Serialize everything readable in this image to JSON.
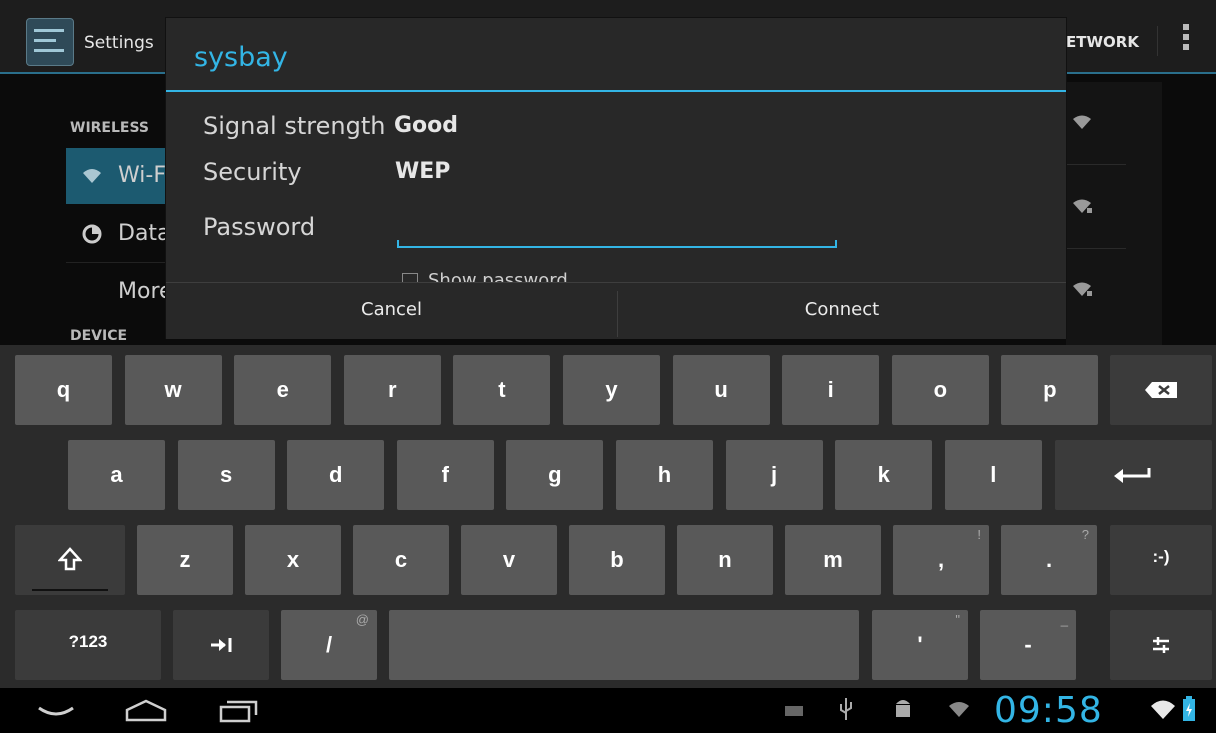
{
  "app": {
    "title": "Settings",
    "network_label": "ETWORK",
    "headers": {
      "wireless": "WIRELESS",
      "device": "DEVICE"
    },
    "sidebar": [
      {
        "label": "Wi-Fi",
        "icon": "wifi-icon",
        "selected": true
      },
      {
        "label": "Data",
        "icon": "data-usage-icon"
      },
      {
        "label": "More"
      }
    ],
    "accent_color": "#33b5e5"
  },
  "dialog": {
    "title": "sysbay",
    "signal_label": "Signal strength",
    "signal_value": "Good",
    "security_label": "Security",
    "security_value": "WEP",
    "password_label": "Password",
    "password_value": "",
    "show_password_label": "Show password",
    "cancel_label": "Cancel",
    "connect_label": "Connect"
  },
  "keyboard": {
    "row1": [
      "q",
      "w",
      "e",
      "r",
      "t",
      "y",
      "u",
      "i",
      "o",
      "p"
    ],
    "row2": [
      "a",
      "s",
      "d",
      "f",
      "g",
      "h",
      "j",
      "k",
      "l"
    ],
    "row3": [
      "z",
      "x",
      "c",
      "v",
      "b",
      "n",
      "m",
      ",",
      "."
    ],
    "row3_hints": [
      "",
      "",
      "",
      "",
      "",
      "",
      "",
      "!",
      "?"
    ],
    "smiley": ":-)",
    "symbols": "?123",
    "slash": "/",
    "slash_hint": "@",
    "apostrophe": "'",
    "apostrophe_hint": "\"",
    "dash": "-",
    "dash_hint": "_"
  },
  "status": {
    "time": "09:58"
  }
}
